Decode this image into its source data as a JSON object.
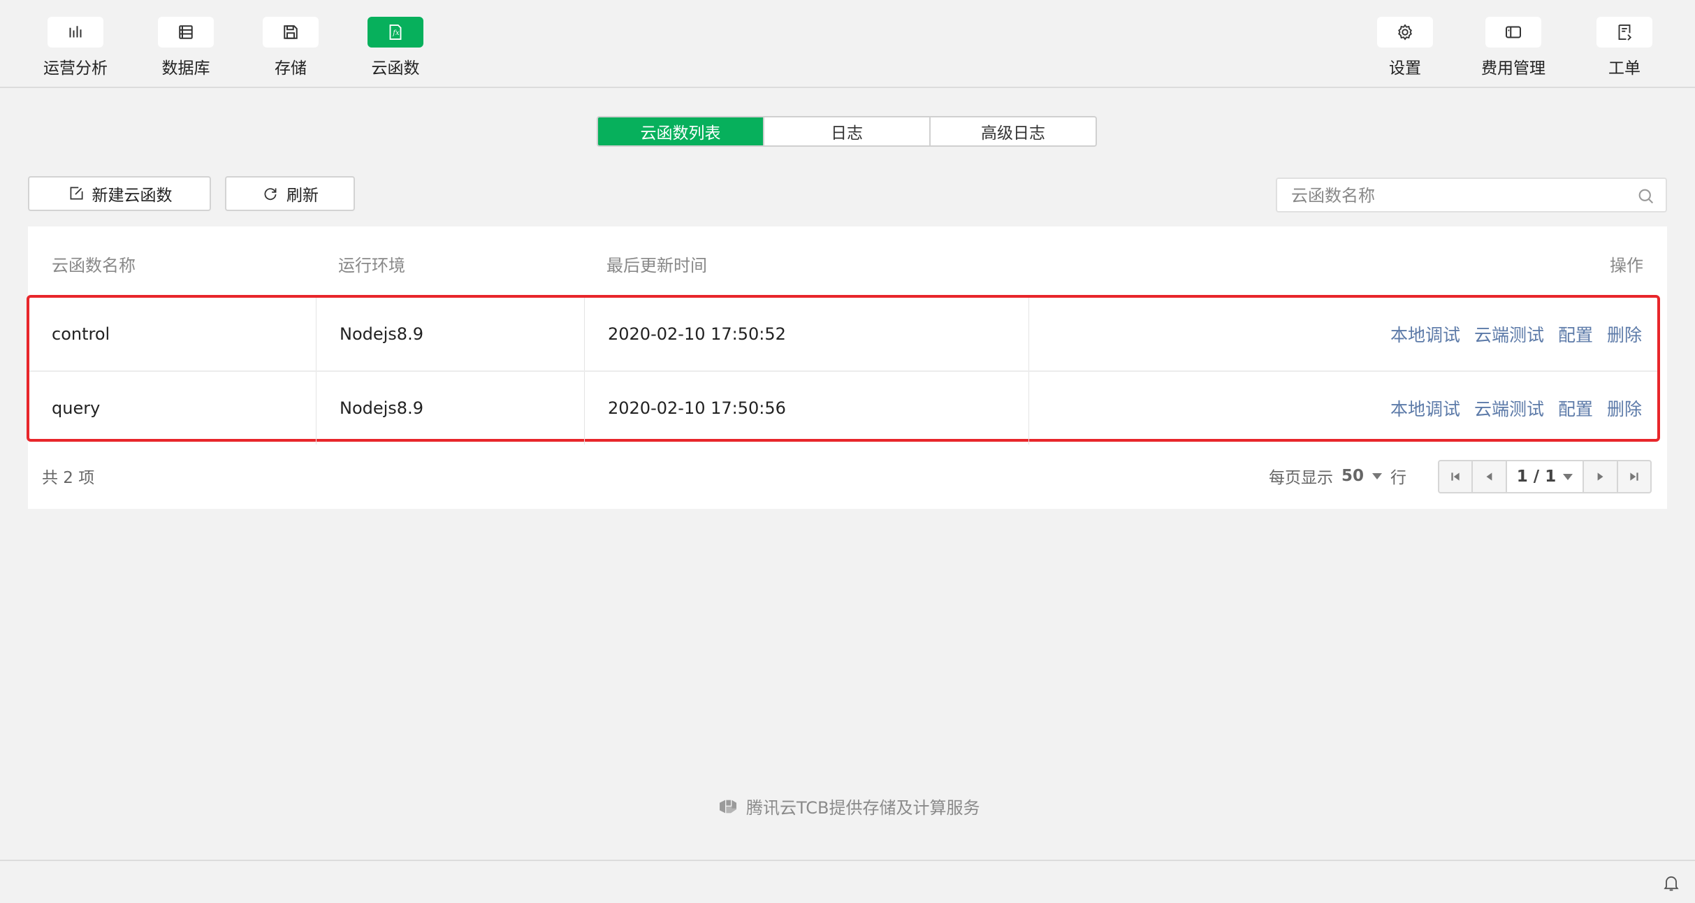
{
  "toolbar": {
    "left": [
      {
        "label": "运营分析",
        "icon": "bar-chart-icon"
      },
      {
        "label": "数据库",
        "icon": "database-icon"
      },
      {
        "label": "存储",
        "icon": "floppy-disk-icon"
      },
      {
        "label": "云函数",
        "icon": "function-fx-icon",
        "active": true
      }
    ],
    "right": [
      {
        "label": "设置",
        "icon": "gear-icon"
      },
      {
        "label": "费用管理",
        "icon": "wallet-icon"
      },
      {
        "label": "工单",
        "icon": "ticket-icon"
      }
    ]
  },
  "tabs": [
    {
      "label": "云函数列表",
      "active": true
    },
    {
      "label": "日志"
    },
    {
      "label": "高级日志"
    }
  ],
  "actions": {
    "new_label": "新建云函数",
    "refresh_label": "刷新"
  },
  "search": {
    "placeholder": "云函数名称",
    "value": ""
  },
  "table": {
    "headers": {
      "name": "云函数名称",
      "runtime": "运行环境",
      "updated": "最后更新时间",
      "ops": "操作"
    },
    "rows": [
      {
        "name": "control",
        "runtime": "Nodejs8.9",
        "updated": "2020-02-10 17:50:52"
      },
      {
        "name": "query",
        "runtime": "Nodejs8.9",
        "updated": "2020-02-10 17:50:56"
      }
    ],
    "row_actions": [
      "本地调试",
      "云端测试",
      "配置",
      "删除"
    ]
  },
  "pagination": {
    "total": "共 2 项",
    "page_size_prefix": "每页显示",
    "page_size": "50",
    "page_size_suffix": "行",
    "page": "1 / 1"
  },
  "footer": {
    "note": "腾讯云TCB提供存储及计算服务"
  },
  "colors": {
    "accent": "#07b05c",
    "link": "#5c7aa8",
    "highlight_border": "#e8262b"
  }
}
